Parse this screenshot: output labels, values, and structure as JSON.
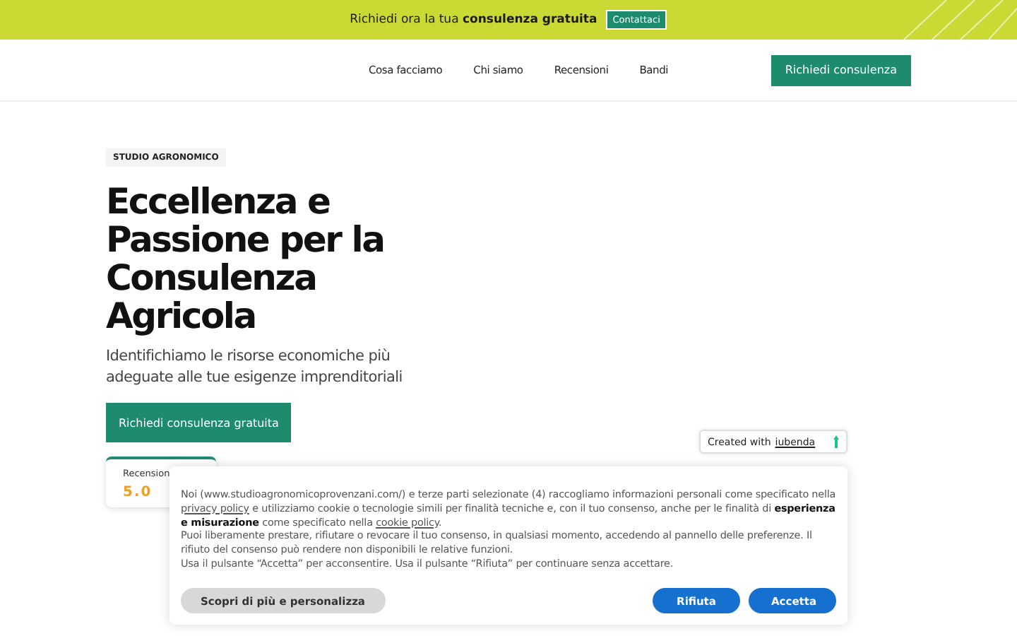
{
  "promo_bar": {
    "text": "Richiedi ora la tua **consulenza gratuita**",
    "button": "Contattaci"
  },
  "nav": {
    "links": [
      "Cosa facciamo",
      "Chi siamo",
      "Recensioni",
      "Bandi"
    ],
    "cta": "Richiedi consulenza"
  },
  "hero": {
    "badge": "STUDIO AGRONOMICO",
    "title": "Eccellenza e Passione per la Consulenza Agricola",
    "subtitle": "Identifichiamo le risorse economiche più adeguate alle tue esigenze imprenditoriali",
    "button": "Richiedi consulenza gratuita",
    "review_card": {
      "label": "Recension",
      "rating": "5.0"
    }
  },
  "iubenda_badge": {
    "text": "Created with",
    "link": "iubenda"
  },
  "cookie_banner": {
    "paragraphs": [
      [
        {
          "kind": "text",
          "text": "Noi (www.studioagronomicoprovenzani.com/) e terze parti selezionate (4) raccogliamo informazioni personali come specificato nella "
        },
        {
          "kind": "link",
          "text": "privacy policy"
        },
        {
          "kind": "text",
          "text": " e utilizziamo cookie o tecnologie simili per finalità tecniche e, con il tuo consenso, anche per le finalità di **esperienza e misurazione** come specificato nella "
        },
        {
          "kind": "link",
          "text": "cookie policy"
        },
        {
          "kind": "text",
          "text": "."
        }
      ],
      [
        {
          "kind": "text",
          "text": "Puoi liberamente prestare, rifiutare o revocare il tuo consenso, in qualsiasi momento, accedendo al pannello delle preferenze. Il rifiuto del consenso può rendere non disponibili le relative funzioni."
        }
      ],
      [
        {
          "kind": "text",
          "text": "Usa il pulsante “Accetta” per acconsentire. Usa il pulsante “Rifiuta” per continuare senza accettare."
        }
      ]
    ],
    "buttons": [
      {
        "kind": "secondary",
        "label": "Scopri di più e personalizza"
      },
      {
        "kind": "primary",
        "label": "Rifiuta"
      },
      {
        "kind": "primary",
        "label": "Accetta"
      }
    ]
  }
}
